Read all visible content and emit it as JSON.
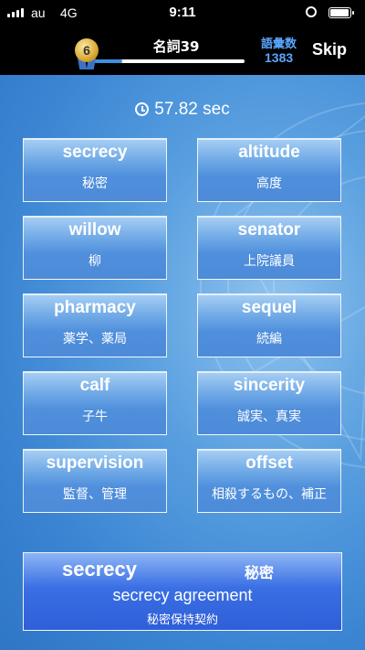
{
  "status_bar": {
    "carrier": "au",
    "network": "4G",
    "time": "9:11"
  },
  "header": {
    "level": "6",
    "title": "名詞39",
    "progress_fraction": 0.2,
    "vocab_label": "語彙数",
    "vocab_count": "1383",
    "skip_label": "Skip"
  },
  "timer": {
    "value": "57.82 sec"
  },
  "cards": [
    {
      "en": "secrecy",
      "jp": "秘密"
    },
    {
      "en": "altitude",
      "jp": "高度"
    },
    {
      "en": "willow",
      "jp": "柳"
    },
    {
      "en": "senator",
      "jp": "上院議員"
    },
    {
      "en": "pharmacy",
      "jp": "薬学、薬局"
    },
    {
      "en": "sequel",
      "jp": "続編"
    },
    {
      "en": "calf",
      "jp": "子牛"
    },
    {
      "en": "sincerity",
      "jp": "誠実、真実"
    },
    {
      "en": "supervision",
      "jp": "監督、管理"
    },
    {
      "en": "offset",
      "jp": "相殺するもの、補正"
    }
  ],
  "answer": {
    "word": "secrecy",
    "meaning": "秘密",
    "phrase": "secrecy agreement",
    "phrase_jp": "秘密保持契約"
  },
  "colors": {
    "accent_blue": "#5aa6ff",
    "header_bg": "#000000",
    "card_blue": "#4f8fdc",
    "answer_blue": "#2f5fd8"
  }
}
